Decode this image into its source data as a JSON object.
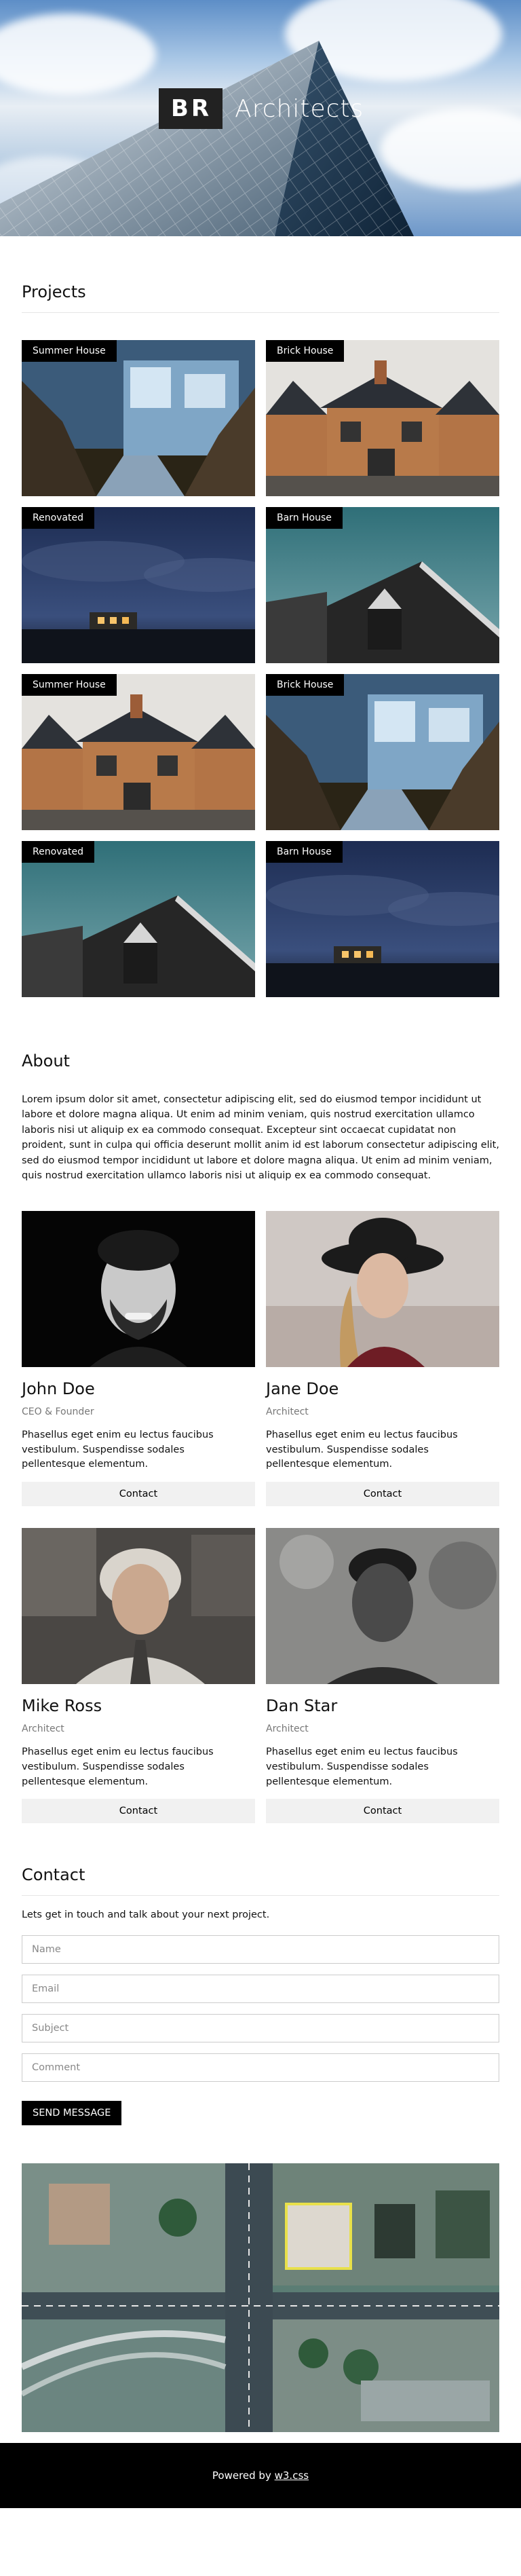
{
  "hero": {
    "brand_initials": "BR",
    "brand_name": "Architects"
  },
  "projects": {
    "title": "Projects",
    "items": [
      {
        "label": "Summer House",
        "image": "glass-house-photo"
      },
      {
        "label": "Brick House",
        "image": "brick-house-photo"
      },
      {
        "label": "Renovated",
        "image": "lit-house-night-photo"
      },
      {
        "label": "Barn House",
        "image": "barn-house-photo"
      },
      {
        "label": "Summer House",
        "image": "brick-house-photo"
      },
      {
        "label": "Brick House",
        "image": "glass-house-photo"
      },
      {
        "label": "Renovated",
        "image": "barn-house-photo"
      },
      {
        "label": "Barn House",
        "image": "lit-house-night-photo"
      }
    ]
  },
  "about": {
    "title": "About",
    "text": "Lorem ipsum dolor sit amet, consectetur adipiscing elit, sed do eiusmod tempor incididunt ut labore et dolore magna aliqua. Ut enim ad minim veniam, quis nostrud exercitation ullamco laboris nisi ut aliquip ex ea commodo consequat. Excepteur sint occaecat cupidatat non proident, sunt in culpa qui officia deserunt mollit anim id est laborum consectetur adipiscing elit, sed do eiusmod tempor incididunt ut labore et dolore magna aliqua. Ut enim ad minim veniam, quis nostrud exercitation ullamco laboris nisi ut aliquip ex ea commodo consequat.",
    "team": [
      {
        "name": "John Doe",
        "role": "CEO & Founder",
        "desc": "Phasellus eget enim eu lectus faucibus vestibulum. Suspendisse sodales pellentesque elementum.",
        "button": "Contact"
      },
      {
        "name": "Jane Doe",
        "role": "Architect",
        "desc": "Phasellus eget enim eu lectus faucibus vestibulum. Suspendisse sodales pellentesque elementum.",
        "button": "Contact"
      },
      {
        "name": "Mike Ross",
        "role": "Architect",
        "desc": "Phasellus eget enim eu lectus faucibus vestibulum. Suspendisse sodales pellentesque elementum.",
        "button": "Contact"
      },
      {
        "name": "Dan Star",
        "role": "Architect",
        "desc": "Phasellus eget enim eu lectus faucibus vestibulum. Suspendisse sodales pellentesque elementum.",
        "button": "Contact"
      }
    ]
  },
  "contact": {
    "title": "Contact",
    "intro": "Lets get in touch and talk about your next project.",
    "fields": {
      "name_placeholder": "Name",
      "email_placeholder": "Email",
      "subject_placeholder": "Subject",
      "comment_placeholder": "Comment"
    },
    "send_label": "SEND MESSAGE"
  },
  "footer": {
    "prefix": "Powered by",
    "link_text": "w3.css"
  },
  "colors": {
    "footer_bg": "#000000",
    "tag_bg": "#000000",
    "button_bg": "#f1f1f1"
  }
}
